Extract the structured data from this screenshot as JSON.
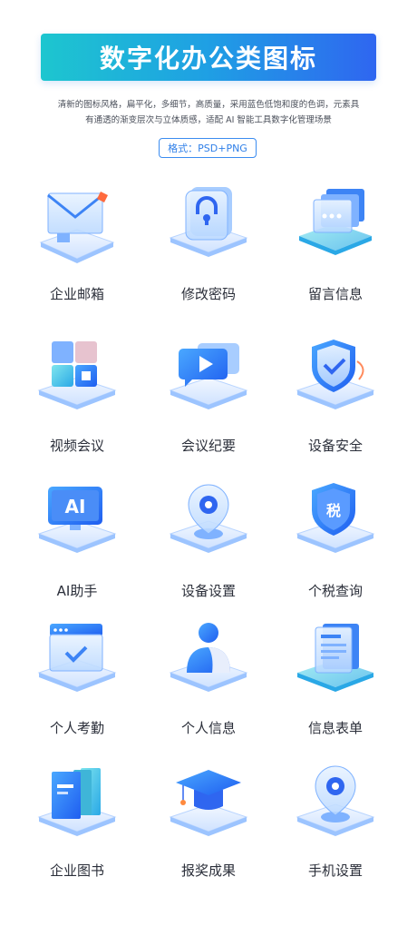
{
  "header": {
    "title": "数字化办公类图标",
    "description_line1": "清新的图标风格，扁平化，多细节，高质量，采用蓝色低饱和度的色调，元素具",
    "description_line2": "有通透的渐变层次与立体质感，适配 AI 智能工具数字化管理场景",
    "format": "格式：PSD+PNG"
  },
  "icons": [
    {
      "label": "企业邮箱",
      "icon": "envelope-icon"
    },
    {
      "label": "修改密码",
      "icon": "lock-icon"
    },
    {
      "label": "留言信息",
      "icon": "message-cards-icon"
    },
    {
      "label": "视频会议",
      "icon": "video-grid-icon"
    },
    {
      "label": "会议纪要",
      "icon": "play-bubble-icon"
    },
    {
      "label": "设备安全",
      "icon": "shield-check-icon"
    },
    {
      "label": "AI助手",
      "icon": "ai-monitor-icon"
    },
    {
      "label": "设备设置",
      "icon": "gear-pin-icon"
    },
    {
      "label": "个税查询",
      "icon": "tax-shield-icon"
    },
    {
      "label": "个人考勤",
      "icon": "browser-check-icon"
    },
    {
      "label": "个人信息",
      "icon": "user-icon"
    },
    {
      "label": "信息表单",
      "icon": "document-form-icon"
    },
    {
      "label": "企业图书",
      "icon": "books-icon"
    },
    {
      "label": "报奖成果",
      "icon": "graduation-cap-icon"
    },
    {
      "label": "手机设置",
      "icon": "gear-pin-icon"
    }
  ],
  "colors": {
    "accent_cyan": "#1dc6cf",
    "accent_blue": "#2f66f0",
    "text": "#2b2f3a"
  }
}
